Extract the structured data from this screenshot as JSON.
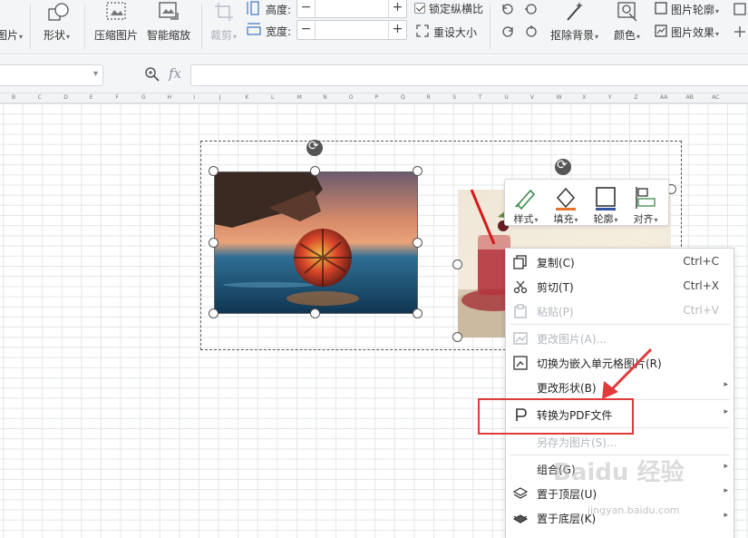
{
  "ribbon": {
    "picture_label": "图片",
    "shape_label": "形状",
    "compress_label": "压缩图片",
    "smart_zoom_label": "智能缩放",
    "crop_label": "裁剪",
    "height_label": "高度:",
    "width_label": "宽度:",
    "height_value": "",
    "width_value": "",
    "lock_ratio_label": "锁定纵横比",
    "reset_size_label": "重设大小",
    "remove_bg_label": "抠除背景",
    "color_label": "颜色",
    "picture_outline_label": "图片轮廓",
    "picture_effects_label": "图片效果"
  },
  "formula_bar": {
    "name_box_value": "",
    "fx_label": "fx",
    "formula_value": ""
  },
  "columns": [
    "B",
    "C",
    "D",
    "E",
    "F",
    "G",
    "H",
    "I",
    "J",
    "K",
    "L",
    "M",
    "N",
    "O",
    "P",
    "Q",
    "R",
    "S",
    "T",
    "U",
    "V",
    "W",
    "X",
    "Y",
    "Z",
    "AA",
    "AB",
    "AC"
  ],
  "mini_toolbar": {
    "style_label": "样式",
    "fill_label": "填充",
    "outline_label": "轮廓",
    "align_label": "对齐"
  },
  "context_menu": {
    "copy": {
      "label": "复制(C)",
      "shortcut": "Ctrl+C"
    },
    "cut": {
      "label": "剪切(T)",
      "shortcut": "Ctrl+X"
    },
    "paste": {
      "label": "粘贴(P)",
      "shortcut": "Ctrl+V"
    },
    "change_picture": {
      "label": "更改图片(A)..."
    },
    "embed_cell": {
      "label": "切换为嵌入单元格图片(R)"
    },
    "change_shape": {
      "label": "更改形状(B)"
    },
    "convert_pdf": {
      "label": "转换为PDF文件"
    },
    "save_as_picture": {
      "label": "另存为图片(S)..."
    },
    "group": {
      "label": "组合(G)"
    },
    "bring_front": {
      "label": "置于顶层(U)"
    },
    "send_back": {
      "label": "置于底层(K)"
    }
  },
  "watermark": {
    "text": "Baidu 经验",
    "url": "jingyan.baidu.com"
  },
  "colors": {
    "highlight": "#e03a3a",
    "arrow": "#e03a3a"
  }
}
